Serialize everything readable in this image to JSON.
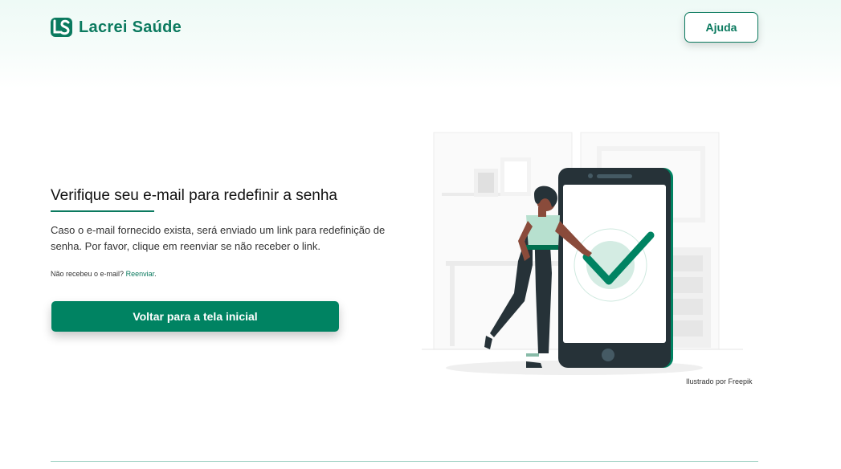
{
  "header": {
    "brand": "Lacrei Saúde",
    "help_label": "Ajuda"
  },
  "main": {
    "title": "Verifique seu e-mail para redefinir a senha",
    "description": "Caso o e-mail fornecido exista, será enviado um link para redefinição de senha. Por favor, clique em reenviar se não receber o link.",
    "resend_prompt": "Não recebeu o e-mail?",
    "resend_link": "Reenviar",
    "resend_suffix": ".",
    "back_button": "Voltar para a tela inicial"
  },
  "illustration": {
    "credit": "Ilustrado por Freepik",
    "icon": "phone-checkmark-illustration"
  },
  "colors": {
    "brand": "#0b7a5f",
    "button": "#008362",
    "background": "#ffffff"
  }
}
